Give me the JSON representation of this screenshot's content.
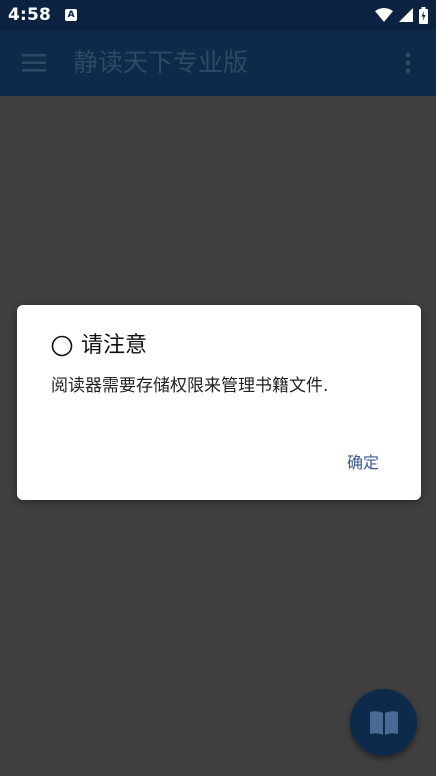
{
  "status_bar": {
    "time": "4:58",
    "badge": "A"
  },
  "app_bar": {
    "title": "静读天下专业版"
  },
  "dialog": {
    "title": "请注意",
    "message": "阅读器需要存储权限来管理书籍文件.",
    "ok_label": "确定"
  },
  "colors": {
    "status_bar_bg": "#0b2340",
    "app_bar_bg": "#0e2a4a",
    "scrim": "#3f3f3f",
    "dialog_bg": "#ffffff",
    "accent": "#3a5a8c"
  },
  "icons": {
    "menu": "menu-icon",
    "overflow": "more-vert-icon",
    "wifi": "wifi-icon",
    "signal": "signal-icon",
    "battery": "battery-icon",
    "title_circle": "circle-icon",
    "fab": "open-book-icon"
  }
}
